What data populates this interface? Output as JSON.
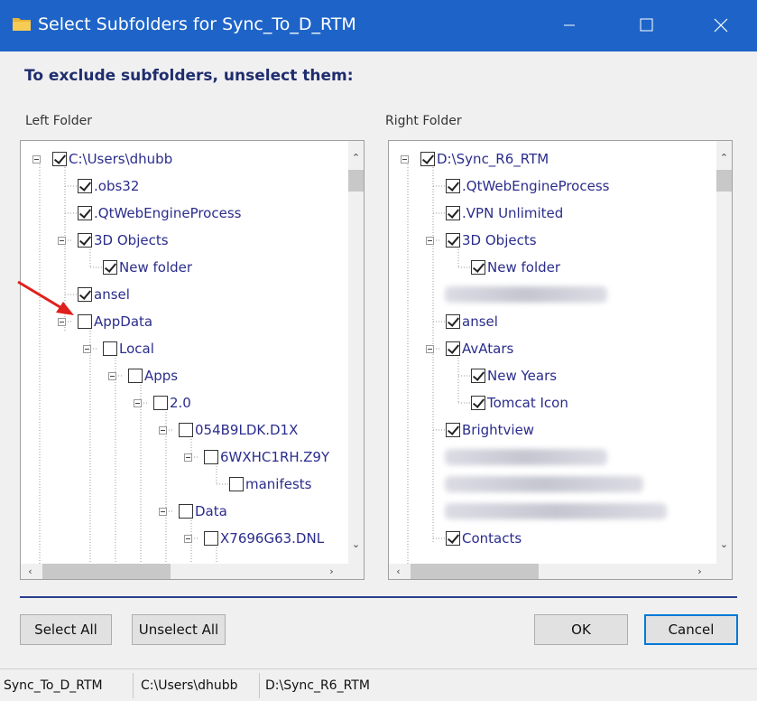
{
  "window": {
    "title": "Select Subfolders for Sync_To_D_RTM",
    "accent_color": "#1e64c8"
  },
  "heading": "To exclude subfolders, unselect them:",
  "left_panel": {
    "label": "Left Folder",
    "nodes": [
      {
        "text": "C:\\Users\\dhubb",
        "checked": true
      },
      {
        "text": ".obs32",
        "checked": true
      },
      {
        "text": ".QtWebEngineProcess",
        "checked": true
      },
      {
        "text": "3D Objects",
        "checked": true
      },
      {
        "text": "New folder",
        "checked": true
      },
      {
        "text": "ansel",
        "checked": true
      },
      {
        "text": "AppData",
        "checked": false
      },
      {
        "text": "Local",
        "checked": false
      },
      {
        "text": "Apps",
        "checked": false
      },
      {
        "text": "2.0",
        "checked": false
      },
      {
        "text": "054B9LDK.D1X",
        "checked": false
      },
      {
        "text": "6WXHC1RH.Z9Y",
        "checked": false
      },
      {
        "text": "manifests",
        "checked": false
      },
      {
        "text": "Data",
        "checked": false
      },
      {
        "text": "X7696G63.DNL",
        "checked": false
      }
    ]
  },
  "right_panel": {
    "label": "Right Folder",
    "nodes": [
      {
        "text": "D:\\Sync_R6_RTM",
        "checked": true
      },
      {
        "text": ".QtWebEngineProcess",
        "checked": true
      },
      {
        "text": ".VPN Unlimited",
        "checked": true
      },
      {
        "text": "3D Objects",
        "checked": true
      },
      {
        "text": "New folder",
        "checked": true
      },
      {
        "text": "ansel",
        "checked": true
      },
      {
        "text": "AvAtars",
        "checked": true
      },
      {
        "text": "New Years",
        "checked": true
      },
      {
        "text": "Tomcat Icon",
        "checked": true
      },
      {
        "text": "Brightview",
        "checked": true
      },
      {
        "text": "Contacts",
        "checked": true
      }
    ]
  },
  "buttons": {
    "select_all": "Select All",
    "unselect_all": "Unselect All",
    "ok": "OK",
    "cancel": "Cancel"
  },
  "status": {
    "job": "Sync_To_D_RTM",
    "left_path": "C:\\Users\\dhubb",
    "right_path": "D:\\Sync_R6_RTM"
  },
  "icons": {
    "title": "folder-icon",
    "minimize": "minimize-icon",
    "maximize": "maximize-icon",
    "close": "close-icon",
    "pointer": "red-arrow-icon"
  }
}
